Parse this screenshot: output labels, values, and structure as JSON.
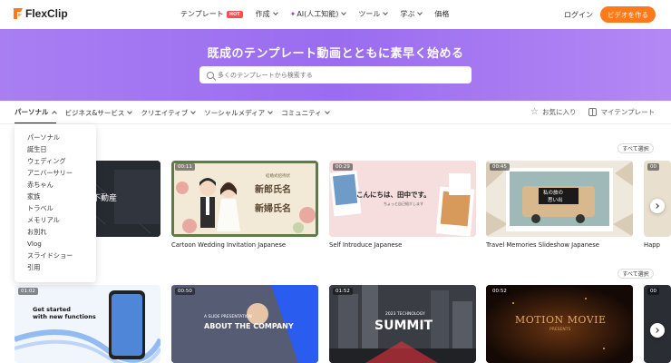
{
  "header": {
    "logo": "FlexClip",
    "nav": [
      {
        "label": "テンプレート",
        "badge": "HOT"
      },
      {
        "label": "作成"
      },
      {
        "label": "AI(人工知能)"
      },
      {
        "label": "ツール"
      },
      {
        "label": "学ぶ"
      },
      {
        "label": "価格"
      }
    ],
    "login": "ログイン",
    "make_video": "ビデオを作る"
  },
  "hero": {
    "title": "既成のテンプレート動画とともに素早く始める",
    "search_placeholder": "多くのテンプレートから検索する"
  },
  "categories": [
    "パーソナル",
    "ビジネス&サービス",
    "クリエイティブ",
    "ソーシャルメディア",
    "コミュニティ"
  ],
  "right_links": {
    "favorites": "お気に入り",
    "my_templates": "マイテンプレート"
  },
  "dropdown": {
    "items": [
      "パーソナル",
      "誕生日",
      "ウェディング",
      "アニバーサリー",
      "赤ちゃん",
      "家族",
      "トラベル",
      "メモリアル",
      "お別れ",
      "Vlog",
      "スライドショー",
      "引用"
    ]
  },
  "see_all": "すべて選択",
  "row1": [
    {
      "duration": "",
      "label": "",
      "overlay": "不動産"
    },
    {
      "duration": "00:11",
      "label": "Cartoon Wedding Invitation Japanese",
      "overlay1": "新郎氏名",
      "overlay2": "新婦氏名",
      "overlay_small": "結婚式招待状"
    },
    {
      "duration": "00:29",
      "label": "Self Introduce Japanese",
      "overlay1": "こんにちは、田中です。",
      "overlay2": "ちょっと自己紹介します"
    },
    {
      "duration": "00:45",
      "label": "Travel Memories Slideshow Japanese",
      "overlay1": "私の旅の",
      "overlay2": "思い出"
    },
    {
      "duration": "00",
      "label": "Happ"
    }
  ],
  "row2": [
    {
      "duration": "01:02",
      "overlay1": "Get started",
      "overlay2": "with new functions"
    },
    {
      "duration": "00:50",
      "overlay1": "A SLIDE PRESENTATION",
      "overlay2": "ABOUT THE COMPANY"
    },
    {
      "duration": "01:52",
      "overlay1": "2023 TECHNOLOGY",
      "overlay2": "SUMMIT"
    },
    {
      "duration": "00:52",
      "overlay1": "MOTION MOVIE",
      "overlay2": "PRESENTS"
    },
    {
      "duration": "00"
    }
  ],
  "colors": {
    "accent": "#ff7a1a",
    "hero": "#9a6cf0",
    "hot": "#ff4d4f"
  }
}
